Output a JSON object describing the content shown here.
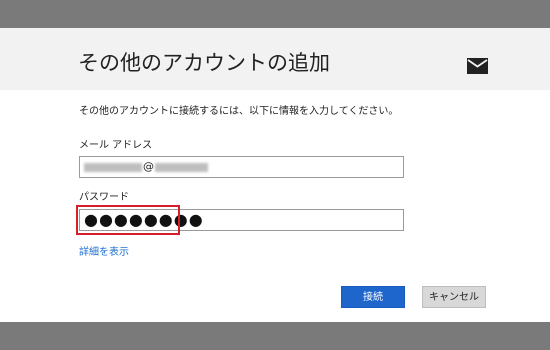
{
  "dialog": {
    "title": "その他のアカウントの追加",
    "description": "その他のアカウントに接続するには、以下に情報を入力してください。"
  },
  "form": {
    "email_label": "メール アドレス",
    "email_value_visible": "@",
    "password_label": "パスワード",
    "password_mask": "●●●●●●●●"
  },
  "links": {
    "details": "詳細を表示"
  },
  "buttons": {
    "connect": "接続",
    "cancel": "キャンセル"
  },
  "icons": {
    "mail": "mail-icon"
  },
  "colors": {
    "header_bg": "#f2f2f2",
    "frame_bar": "#7a7a7a",
    "primary_button": "#1f66cc",
    "link": "#1f6fd1",
    "highlight": "#d4202a"
  }
}
